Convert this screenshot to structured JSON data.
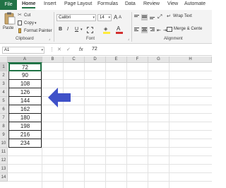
{
  "tabs": {
    "file": "File",
    "home": "Home",
    "insert": "Insert",
    "page_layout": "Page Layout",
    "formulas": "Formulas",
    "data": "Data",
    "review": "Review",
    "view": "View",
    "automate": "Automate"
  },
  "clipboard": {
    "paste": "Paste",
    "cut": "Cut",
    "copy": "Copy",
    "format_painter": "Format Painter",
    "label": "Clipboard"
  },
  "font": {
    "name": "Calibri",
    "size": "14",
    "label": "Font",
    "bold": "B",
    "italic": "I",
    "underline": "U"
  },
  "alignment": {
    "wrap_text": "Wrap Text",
    "merge_center": "Merge & Cente",
    "label": "Alignment"
  },
  "formula_bar": {
    "name_box": "A1",
    "fx": "fx",
    "value": "72"
  },
  "columns": [
    "A",
    "B",
    "C",
    "D",
    "E",
    "F",
    "G",
    "H"
  ],
  "rows": [
    "1",
    "2",
    "3",
    "4",
    "5",
    "6",
    "7",
    "8",
    "9",
    "10",
    "11",
    "12",
    "13",
    "14"
  ],
  "column_a_values": [
    "72",
    "90",
    "108",
    "126",
    "144",
    "162",
    "180",
    "198",
    "216",
    "234"
  ],
  "colors": {
    "accent": "#217346",
    "arrow": "#3f51c8",
    "font_color_bar": "#d32f2f",
    "highlight_bar": "#ffeb3b"
  },
  "arrow": {
    "icon": "left-arrow-icon"
  }
}
